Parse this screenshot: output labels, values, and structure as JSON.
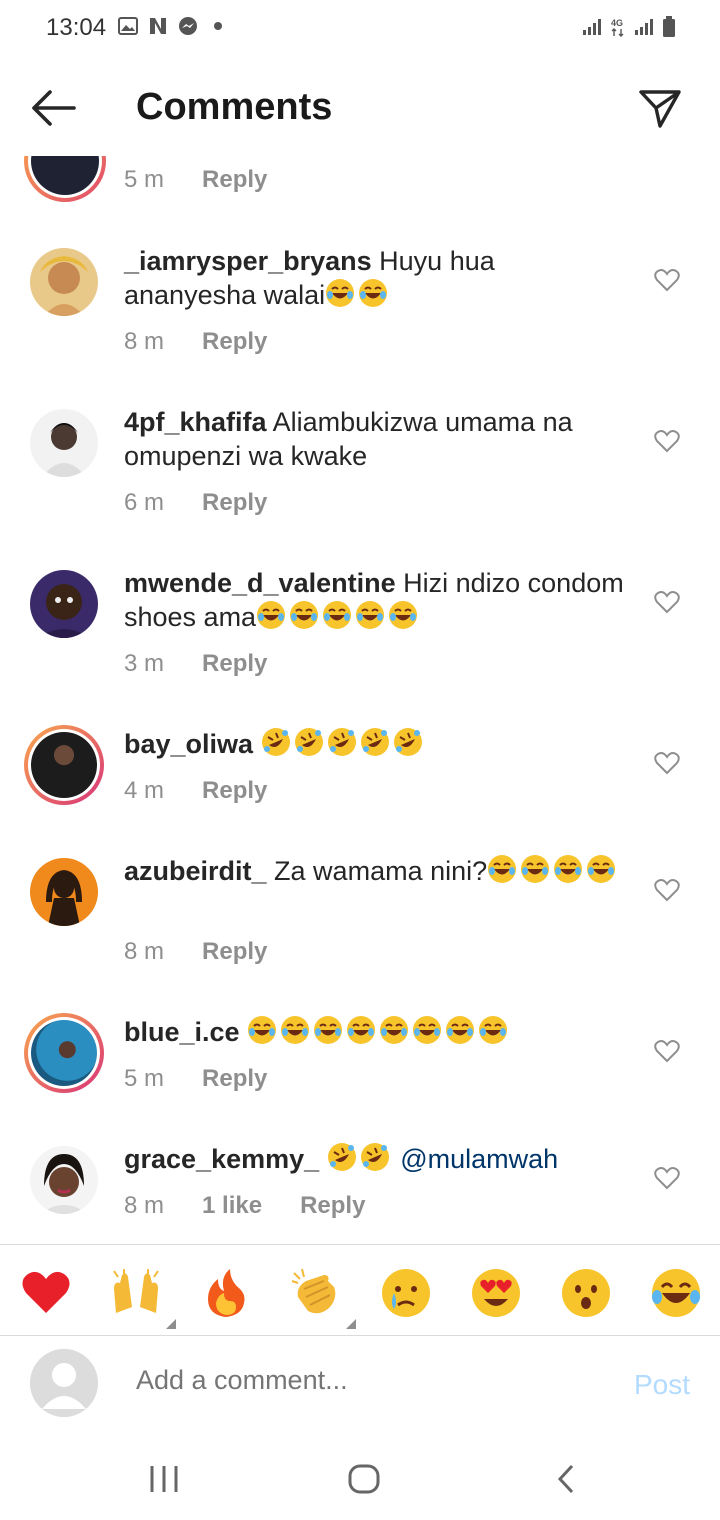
{
  "status_bar": {
    "time": "13:04",
    "icons_left": [
      "gallery-icon",
      "netflix-icon",
      "messenger-icon",
      "dot-icon"
    ],
    "icons_right": [
      "signal-icon",
      "4g-icon",
      "signal-icon",
      "battery-icon"
    ]
  },
  "header": {
    "title": "Comments",
    "back_icon": "arrow-left-icon",
    "send_icon": "paper-plane-icon"
  },
  "partial_comment": {
    "time": "5 m",
    "reply": "Reply"
  },
  "comments": [
    {
      "username": "_iamrysper_bryans",
      "text": "Huyu hua ananyesha walai",
      "emoji_after": [
        "joy",
        "joy"
      ],
      "time": "8 m",
      "reply": "Reply"
    },
    {
      "username": "4pf_khafifa",
      "text": "Aliambukizwa umama na omupenzi wa kwake",
      "time": "6 m",
      "reply": "Reply"
    },
    {
      "username": "mwende_d_valentine",
      "text": "Hizi ndizo condom shoes ama",
      "emoji_after": [
        "joy",
        "joy",
        "joy",
        "joy",
        "joy"
      ],
      "time": "3 m",
      "reply": "Reply"
    },
    {
      "username": "bay_oliwa",
      "text": "",
      "emoji_after": [
        "rofl",
        "rofl",
        "rofl",
        "rofl",
        "rofl"
      ],
      "time": "4 m",
      "reply": "Reply"
    },
    {
      "username": "azubeirdit_",
      "text": "Za wamama nini?",
      "emoji_after": [
        "joy",
        "joy",
        "joy",
        "joy"
      ],
      "time": "8 m",
      "reply": "Reply"
    },
    {
      "username": "blue_i.ce",
      "text": "",
      "emoji_after": [
        "joy",
        "joy",
        "joy",
        "joy",
        "joy",
        "joy",
        "joy",
        "joy"
      ],
      "time": "5 m",
      "reply": "Reply"
    },
    {
      "username": "grace_kemmy_",
      "text": "",
      "emoji_after": [
        "rofl",
        "rofl"
      ],
      "mention": "@mulamwah",
      "time": "8 m",
      "likes": "1 like",
      "reply": "Reply"
    }
  ],
  "reactions": [
    "red-heart",
    "raising-hands",
    "fire",
    "clapping-hands",
    "crying-face",
    "heart-eyes",
    "surprised-face",
    "tears-of-joy"
  ],
  "composer": {
    "placeholder": "Add a comment...",
    "post_label": "Post"
  },
  "colors": {
    "accent": "#3897f0",
    "post_disabled": "#b3dbff",
    "secondary_text": "#8e8e8e",
    "mention": "#003569"
  }
}
